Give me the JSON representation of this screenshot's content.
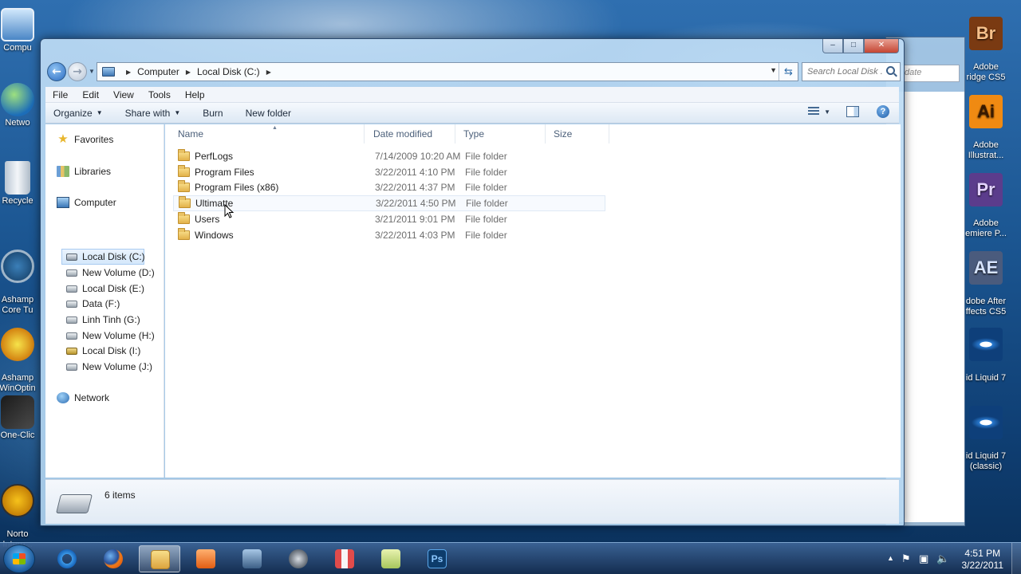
{
  "desktop_left": [
    {
      "label": "Compu",
      "icon": "computer-icon"
    },
    {
      "label": "Netwo",
      "icon": "network-icon"
    },
    {
      "label": "Recycle",
      "icon": "recycle-bin-icon"
    },
    {
      "label": "Ashamp\nCore Tu",
      "icon": "ashampoo-icon"
    },
    {
      "label": "Ashamp\nWinOptin",
      "icon": "winoptimizer-icon"
    },
    {
      "label": "One-Clic",
      "icon": "one-click-icon"
    },
    {
      "label": "Norto\nIntern...",
      "icon": "norton-icon"
    }
  ],
  "desktop_right": [
    {
      "badge": "Br",
      "label": "Adobe\nridge CS5",
      "color": "#7a3a12",
      "fg": "#f7c08a"
    },
    {
      "badge": "Ai",
      "label": "Adobe\nIllustrat...",
      "color": "#f08a12",
      "fg": "#3a1a00"
    },
    {
      "badge": "Pr",
      "label": "Adobe\nemiere P...",
      "color": "#5b3c8c",
      "fg": "#e3d3ff"
    },
    {
      "badge": "AE",
      "label": "dobe After\nffects CS5",
      "color": "#4a5b7d",
      "fg": "#d6e3ff"
    },
    {
      "badge": "",
      "label": "id Liquid 7",
      "color": "#1b5fa8",
      "fg": "#ffffff"
    },
    {
      "badge": "",
      "label": "id Liquid 7\n(classic)",
      "color": "#1b5fa8",
      "fg": "#ffffff"
    }
  ],
  "bg_window": {
    "search_text": "date"
  },
  "window": {
    "minimize": "–",
    "maximize": "□",
    "close": "✕"
  },
  "address": {
    "crumbs": [
      "Computer",
      "Local Disk (C:)"
    ]
  },
  "search": {
    "placeholder": "Search Local Disk ..."
  },
  "menu": [
    "File",
    "Edit",
    "View",
    "Tools",
    "Help"
  ],
  "commands": {
    "organize": "Organize",
    "share": "Share with",
    "burn": "Burn",
    "new_folder": "New folder"
  },
  "navpane": {
    "favorites": "Favorites",
    "libraries": "Libraries",
    "computer": "Computer",
    "drives": [
      "Local Disk (C:)",
      "New Volume (D:)",
      "Local Disk (E:)",
      "Data (F:)",
      "Linh Tinh (G:)",
      "New Volume (H:)",
      "Local Disk (I:)",
      "New Volume (J:)"
    ],
    "network": "Network"
  },
  "columns": {
    "name": "Name",
    "date": "Date modified",
    "type": "Type",
    "size": "Size"
  },
  "files": [
    {
      "name": "PerfLogs",
      "date": "7/14/2009 10:20 AM",
      "type": "File folder"
    },
    {
      "name": "Program Files",
      "date": "3/22/2011 4:10 PM",
      "type": "File folder"
    },
    {
      "name": "Program Files (x86)",
      "date": "3/22/2011 4:37 PM",
      "type": "File folder"
    },
    {
      "name": "Ultimatte",
      "date": "3/22/2011 4:50 PM",
      "type": "File folder"
    },
    {
      "name": "Users",
      "date": "3/21/2011 9:01 PM",
      "type": "File folder"
    },
    {
      "name": "Windows",
      "date": "3/22/2011 4:03 PM",
      "type": "File folder"
    }
  ],
  "details": {
    "count": "6 items"
  },
  "taskbar": {
    "apps": [
      "internet-explorer-icon",
      "firefox-icon",
      "windows-explorer-icon",
      "media-player-icon",
      "network-monitor-icon",
      "clock-app-icon",
      "paint-icon",
      "notes-icon",
      "photoshop-icon"
    ],
    "time": "4:51 PM",
    "date": "3/22/2011"
  }
}
